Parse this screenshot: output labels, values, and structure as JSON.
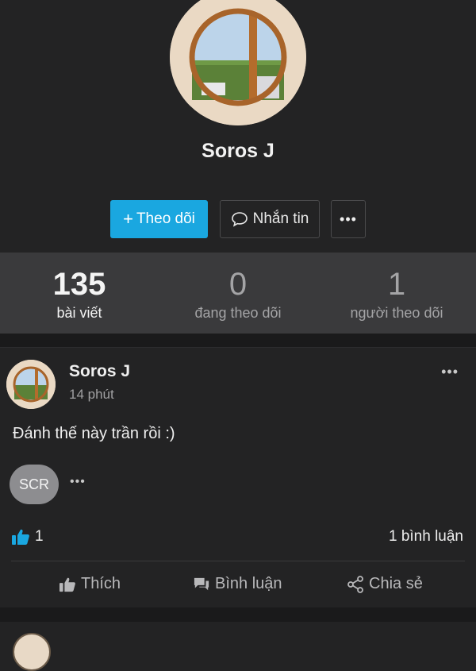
{
  "profile": {
    "name": "Soros J",
    "follow_label": "Theo dõi",
    "message_label": "Nhắn tin",
    "more_label": "•••"
  },
  "stats": [
    {
      "number": "135",
      "label": "bài viết"
    },
    {
      "number": "0",
      "label": "đang theo dõi"
    },
    {
      "number": "1",
      "label": "người theo dõi"
    }
  ],
  "post": {
    "author": "Soros J",
    "time": "14 phút",
    "menu": "•••",
    "text": "Đánh thế này trần rồi :)",
    "badge": "SCR",
    "badge_more": "•••",
    "like_count": "1",
    "comment_count": "1 bình luận",
    "actions": {
      "like": "Thích",
      "comment": "Bình luận",
      "share": "Chia sẻ"
    }
  },
  "colors": {
    "accent": "#1aa7e0",
    "background": "#232324",
    "stats_bg": "#3a3a3c"
  }
}
